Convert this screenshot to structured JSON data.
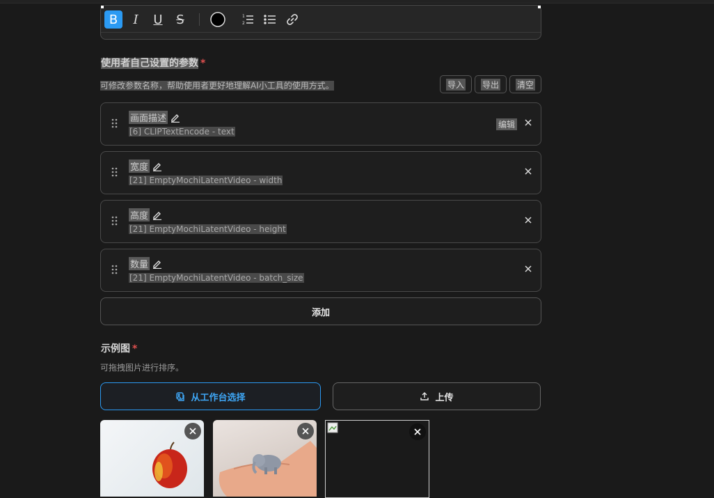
{
  "toolbar": {
    "buttons": [
      "B",
      "I",
      "U",
      "S"
    ]
  },
  "params_section": {
    "title": "使用者自己设置的参数",
    "required_mark": "*",
    "hint": "可修改参数名称，帮助使用者更好地理解AI小工具的使用方式。",
    "import_label": "导入",
    "export_label": "导出",
    "clear_label": "清空",
    "items": [
      {
        "name": "画面描述",
        "source": "[6] CLIPTextEncode - text",
        "edit_label": "编辑"
      },
      {
        "name": "宽度",
        "source": "[21] EmptyMochiLatentVideo - width"
      },
      {
        "name": "高度",
        "source": "[21] EmptyMochiLatentVideo - height"
      },
      {
        "name": "数量",
        "source": "[21] EmptyMochiLatentVideo - batch_size"
      }
    ],
    "add_label": "添加"
  },
  "examples_section": {
    "title": "示例图",
    "required_mark": "*",
    "hint": "可拖拽图片进行排序。",
    "workspace_label": "从工作台选择",
    "upload_label": "上传"
  },
  "colors": {
    "accent": "#2b9af3",
    "required": "#e0504f",
    "background": "#1a1a1a"
  }
}
